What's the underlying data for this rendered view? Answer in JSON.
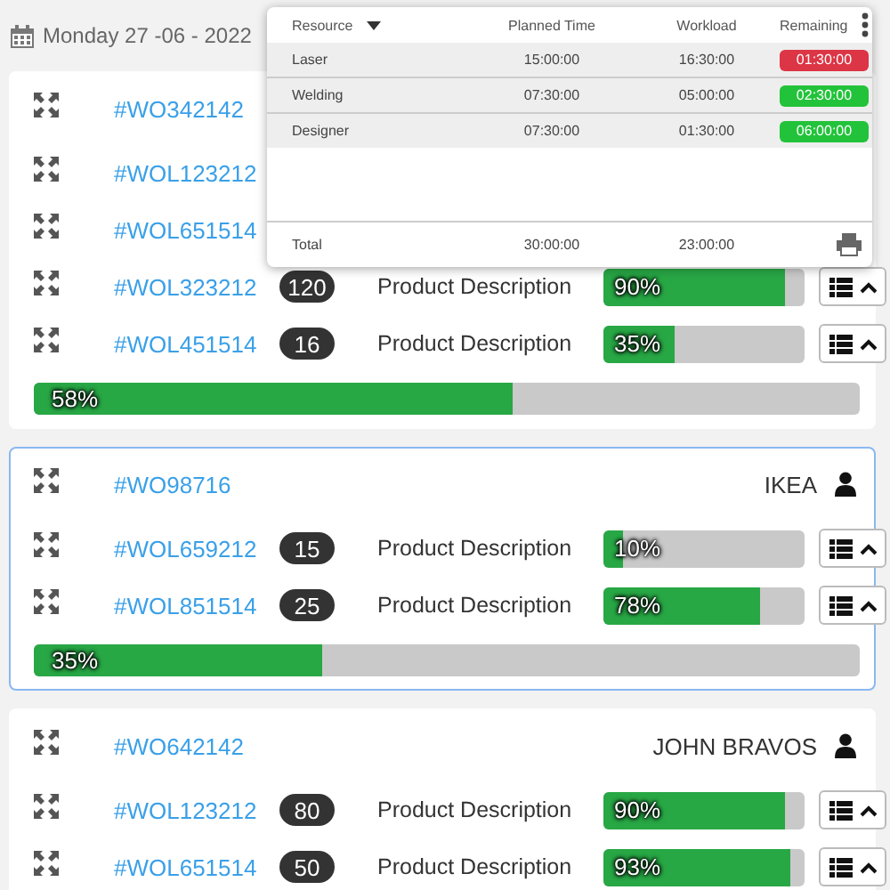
{
  "date": "Monday 27 -06 - 2022",
  "orders": [
    {
      "id": "#WO342142",
      "selected": false,
      "lines": [
        {
          "id": "#WOL123212"
        },
        {
          "id": "#WOL651514"
        },
        {
          "id": "#WOL323212",
          "badge": "120",
          "description": "Product Description",
          "level": 0.9,
          "reading": "90%"
        },
        {
          "id": "#WOL451514",
          "badge": "16",
          "description": "Product Description",
          "level": 0.35,
          "reading": "35%"
        }
      ],
      "level": 0.58,
      "reading": "58%"
    },
    {
      "id": "#WO98716",
      "customer": "IKEA",
      "selected": true,
      "lines": [
        {
          "id": "#WOL659212",
          "badge": "15",
          "description": "Product Description",
          "level": 0.1,
          "reading": "10%"
        },
        {
          "id": "#WOL851514",
          "badge": "25",
          "description": "Product Description",
          "level": 0.78,
          "reading": "78%"
        }
      ],
      "level": 0.35,
      "reading": "35%"
    },
    {
      "id": "#WO642142",
      "customer": "JOHN BRAVOS",
      "selected": false,
      "lines": [
        {
          "id": "#WOL123212",
          "badge": "80",
          "description": "Product Description",
          "level": 0.9,
          "reading": "90%"
        },
        {
          "id": "#WOL651514",
          "badge": "50",
          "description": "Product Description",
          "level": 0.93,
          "reading": "93%"
        }
      ]
    }
  ],
  "popup": {
    "columns": [
      "Resource",
      "Planned Time",
      "Workload",
      "Remaining"
    ],
    "rows": [
      {
        "resource": "Laser",
        "planned": "15:00:00",
        "workload": "16:30:00",
        "remaining": "01:30:00",
        "color": "#dc3545"
      },
      {
        "resource": "Welding",
        "planned": "07:30:00",
        "workload": "05:00:00",
        "remaining": "02:30:00",
        "color": "#22c33a"
      },
      {
        "resource": "Designer",
        "planned": "07:30:00",
        "workload": "01:30:00",
        "remaining": "06:00:00",
        "color": "#22c33a"
      }
    ],
    "total": {
      "label": "Total",
      "planned": "30:00:00",
      "workload": "23:00:00"
    }
  }
}
